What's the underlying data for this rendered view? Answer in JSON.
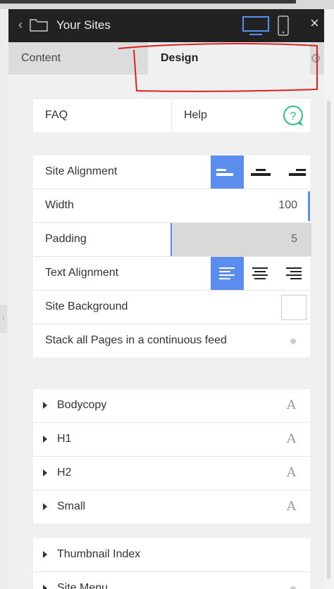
{
  "header": {
    "back_glyph": "‹",
    "title": "Your Sites",
    "icons": [
      "folder-icon",
      "desktop-icon",
      "mobile-icon"
    ],
    "close_glyph": "×"
  },
  "tabs": {
    "content": "Content",
    "design": "Design",
    "settings_icon": "gear-icon"
  },
  "help_row": {
    "faq": "FAQ",
    "help": "Help",
    "icon": "question-icon"
  },
  "settings": {
    "site_alignment": {
      "label": "Site Alignment",
      "options": [
        "left",
        "center",
        "right"
      ],
      "selected": "left"
    },
    "width": {
      "label": "Width",
      "value": "100"
    },
    "padding": {
      "label": "Padding",
      "value": "5"
    },
    "text_alignment": {
      "label": "Text Alignment",
      "options": [
        "left",
        "center",
        "right"
      ],
      "selected": "left"
    },
    "site_background": {
      "label": "Site Background",
      "color": "#ffffff"
    },
    "stack_pages": {
      "label": "Stack all Pages in a continuous feed",
      "enabled": false
    }
  },
  "typography": [
    {
      "label": "Bodycopy",
      "icon": "A"
    },
    {
      "label": "H1",
      "icon": "A"
    },
    {
      "label": "H2",
      "icon": "A"
    },
    {
      "label": "Small",
      "icon": "A"
    }
  ],
  "lower": [
    {
      "label": "Thumbnail Index"
    },
    {
      "label": "Site Menu"
    }
  ],
  "colors": {
    "accent": "#5b8def",
    "annotation": "#e02020",
    "header_bg": "#222222",
    "help_icon": "#2bbf8a"
  }
}
